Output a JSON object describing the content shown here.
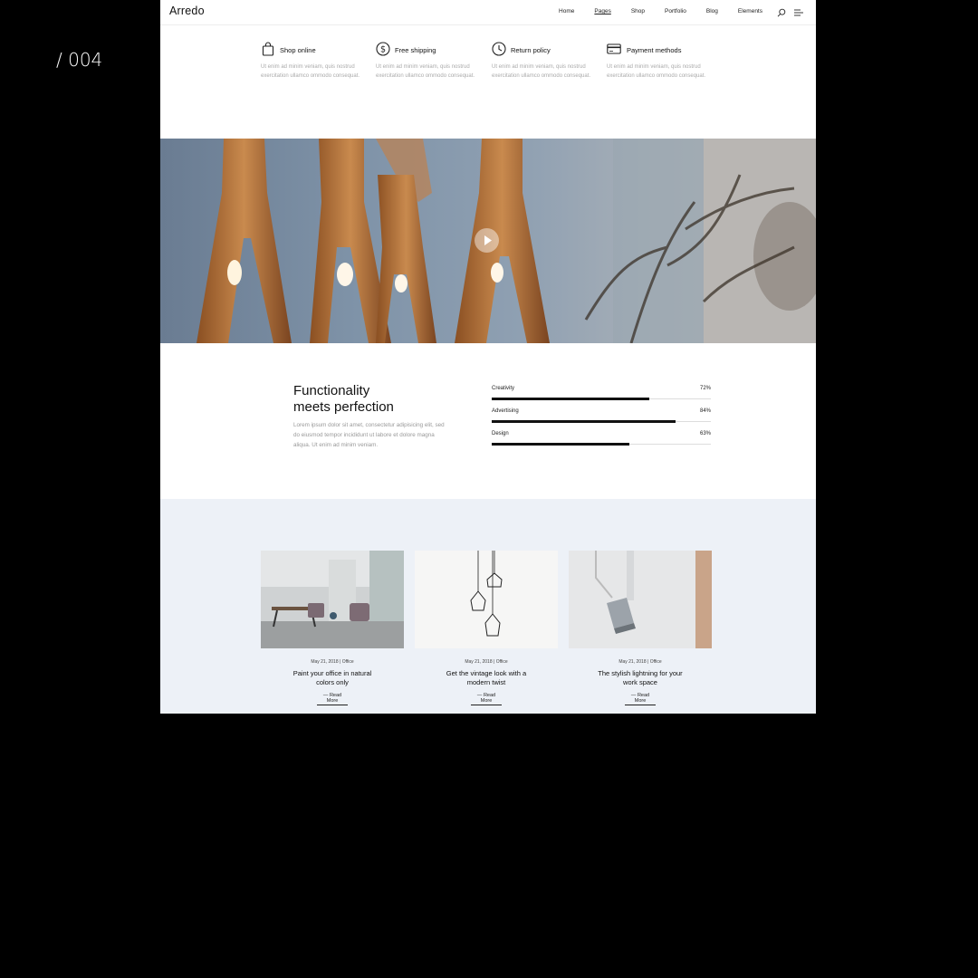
{
  "slide_label": "/ 004",
  "header": {
    "logo": "Arredo",
    "nav": [
      {
        "label": "Home",
        "active": false
      },
      {
        "label": "Pages",
        "active": true
      },
      {
        "label": "Shop",
        "active": false
      },
      {
        "label": "Portfolio",
        "active": false
      },
      {
        "label": "Blog",
        "active": false
      },
      {
        "label": "Elements",
        "active": false
      }
    ],
    "icons": [
      "search-icon",
      "menu-icon"
    ]
  },
  "features": [
    {
      "icon": "shopping-bag-icon",
      "title": "Shop online",
      "text": "Ut enim ad minim veniam, quis nostrud exercitation ullamco ommodo consequat."
    },
    {
      "icon": "dollar-icon",
      "title": "Free shipping",
      "text": "Ut enim ad minim veniam, quis nostrud exercitation ullamco ommodo consequat."
    },
    {
      "icon": "clock-icon",
      "title": "Return policy",
      "text": "Ut enim ad minim veniam, quis nostrud exercitation ullamco ommodo consequat."
    },
    {
      "icon": "credit-card-icon",
      "title": "Payment methods",
      "text": "Ut enim ad minim veniam, quis nostrud exercitation ullamco ommodo consequat."
    }
  ],
  "hero": {
    "play_icon": "play-icon"
  },
  "functionality": {
    "heading_line1": "Functionality",
    "heading_line2": "meets perfection",
    "text": "Lorem ipsum dolor sit amet, consectetur adipisicing elit, sed do eiusmod tempor incididunt ut labore et dolore magna aliqua. Ut enim ad minim veniam.",
    "bars": [
      {
        "label": "Creativity",
        "value_text": "72%",
        "value": 72
      },
      {
        "label": "Advertising",
        "value_text": "84%",
        "value": 84
      },
      {
        "label": "Design",
        "value_text": "63%",
        "value": 63
      }
    ]
  },
  "posts": [
    {
      "date": "May 21, 2018",
      "category": "Office",
      "title_line1": "Paint your office in natural",
      "title_line2": "colors only",
      "read_more": "Read More"
    },
    {
      "date": "May 21, 2018",
      "category": "Office",
      "title_line1": "Get the vintage look with a",
      "title_line2": "modern twist",
      "read_more": "Read More"
    },
    {
      "date": "May 21, 2018",
      "category": "Office",
      "title_line1": "The stylish lightning for your",
      "title_line2": "work space",
      "read_more": "Read More"
    }
  ],
  "colors": {
    "page_bg": "#000000",
    "site_bg": "#ffffff",
    "blog_bg": "#edf1f7",
    "accent": "#111111"
  }
}
